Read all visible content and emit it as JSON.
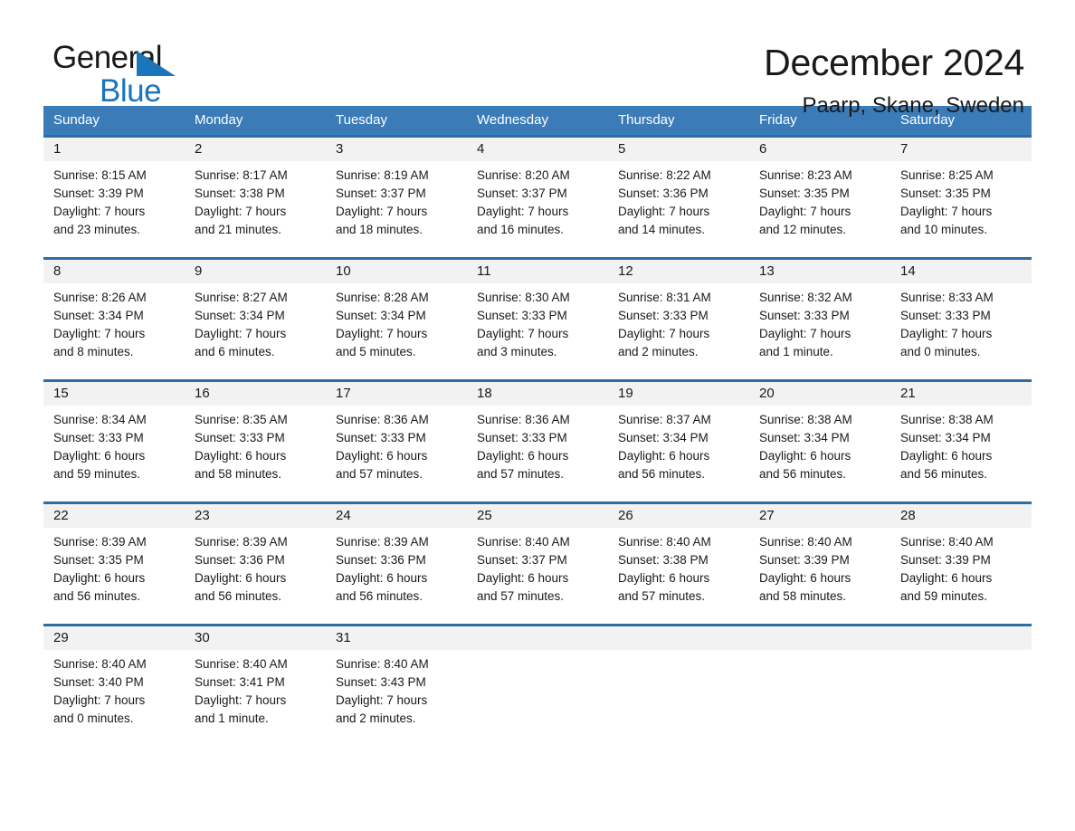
{
  "brand": {
    "name_top": "General",
    "name_bottom": "Blue",
    "accent_color": "#1b75bb"
  },
  "header": {
    "title": "December 2024",
    "subtitle": "Paarp, Skane, Sweden"
  },
  "theme": {
    "header_bg": "#3b7cb8",
    "row_border": "#2e6da4",
    "day_number_bg": "#f2f2f2",
    "text": "#1a1a1a"
  },
  "weekdays": [
    "Sunday",
    "Monday",
    "Tuesday",
    "Wednesday",
    "Thursday",
    "Friday",
    "Saturday"
  ],
  "weeks": [
    [
      {
        "day": "1",
        "sunrise": "Sunrise: 8:15 AM",
        "sunset": "Sunset: 3:39 PM",
        "daylight_line1": "Daylight: 7 hours",
        "daylight_line2": "and 23 minutes."
      },
      {
        "day": "2",
        "sunrise": "Sunrise: 8:17 AM",
        "sunset": "Sunset: 3:38 PM",
        "daylight_line1": "Daylight: 7 hours",
        "daylight_line2": "and 21 minutes."
      },
      {
        "day": "3",
        "sunrise": "Sunrise: 8:19 AM",
        "sunset": "Sunset: 3:37 PM",
        "daylight_line1": "Daylight: 7 hours",
        "daylight_line2": "and 18 minutes."
      },
      {
        "day": "4",
        "sunrise": "Sunrise: 8:20 AM",
        "sunset": "Sunset: 3:37 PM",
        "daylight_line1": "Daylight: 7 hours",
        "daylight_line2": "and 16 minutes."
      },
      {
        "day": "5",
        "sunrise": "Sunrise: 8:22 AM",
        "sunset": "Sunset: 3:36 PM",
        "daylight_line1": "Daylight: 7 hours",
        "daylight_line2": "and 14 minutes."
      },
      {
        "day": "6",
        "sunrise": "Sunrise: 8:23 AM",
        "sunset": "Sunset: 3:35 PM",
        "daylight_line1": "Daylight: 7 hours",
        "daylight_line2": "and 12 minutes."
      },
      {
        "day": "7",
        "sunrise": "Sunrise: 8:25 AM",
        "sunset": "Sunset: 3:35 PM",
        "daylight_line1": "Daylight: 7 hours",
        "daylight_line2": "and 10 minutes."
      }
    ],
    [
      {
        "day": "8",
        "sunrise": "Sunrise: 8:26 AM",
        "sunset": "Sunset: 3:34 PM",
        "daylight_line1": "Daylight: 7 hours",
        "daylight_line2": "and 8 minutes."
      },
      {
        "day": "9",
        "sunrise": "Sunrise: 8:27 AM",
        "sunset": "Sunset: 3:34 PM",
        "daylight_line1": "Daylight: 7 hours",
        "daylight_line2": "and 6 minutes."
      },
      {
        "day": "10",
        "sunrise": "Sunrise: 8:28 AM",
        "sunset": "Sunset: 3:34 PM",
        "daylight_line1": "Daylight: 7 hours",
        "daylight_line2": "and 5 minutes."
      },
      {
        "day": "11",
        "sunrise": "Sunrise: 8:30 AM",
        "sunset": "Sunset: 3:33 PM",
        "daylight_line1": "Daylight: 7 hours",
        "daylight_line2": "and 3 minutes."
      },
      {
        "day": "12",
        "sunrise": "Sunrise: 8:31 AM",
        "sunset": "Sunset: 3:33 PM",
        "daylight_line1": "Daylight: 7 hours",
        "daylight_line2": "and 2 minutes."
      },
      {
        "day": "13",
        "sunrise": "Sunrise: 8:32 AM",
        "sunset": "Sunset: 3:33 PM",
        "daylight_line1": "Daylight: 7 hours",
        "daylight_line2": "and 1 minute."
      },
      {
        "day": "14",
        "sunrise": "Sunrise: 8:33 AM",
        "sunset": "Sunset: 3:33 PM",
        "daylight_line1": "Daylight: 7 hours",
        "daylight_line2": "and 0 minutes."
      }
    ],
    [
      {
        "day": "15",
        "sunrise": "Sunrise: 8:34 AM",
        "sunset": "Sunset: 3:33 PM",
        "daylight_line1": "Daylight: 6 hours",
        "daylight_line2": "and 59 minutes."
      },
      {
        "day": "16",
        "sunrise": "Sunrise: 8:35 AM",
        "sunset": "Sunset: 3:33 PM",
        "daylight_line1": "Daylight: 6 hours",
        "daylight_line2": "and 58 minutes."
      },
      {
        "day": "17",
        "sunrise": "Sunrise: 8:36 AM",
        "sunset": "Sunset: 3:33 PM",
        "daylight_line1": "Daylight: 6 hours",
        "daylight_line2": "and 57 minutes."
      },
      {
        "day": "18",
        "sunrise": "Sunrise: 8:36 AM",
        "sunset": "Sunset: 3:33 PM",
        "daylight_line1": "Daylight: 6 hours",
        "daylight_line2": "and 57 minutes."
      },
      {
        "day": "19",
        "sunrise": "Sunrise: 8:37 AM",
        "sunset": "Sunset: 3:34 PM",
        "daylight_line1": "Daylight: 6 hours",
        "daylight_line2": "and 56 minutes."
      },
      {
        "day": "20",
        "sunrise": "Sunrise: 8:38 AM",
        "sunset": "Sunset: 3:34 PM",
        "daylight_line1": "Daylight: 6 hours",
        "daylight_line2": "and 56 minutes."
      },
      {
        "day": "21",
        "sunrise": "Sunrise: 8:38 AM",
        "sunset": "Sunset: 3:34 PM",
        "daylight_line1": "Daylight: 6 hours",
        "daylight_line2": "and 56 minutes."
      }
    ],
    [
      {
        "day": "22",
        "sunrise": "Sunrise: 8:39 AM",
        "sunset": "Sunset: 3:35 PM",
        "daylight_line1": "Daylight: 6 hours",
        "daylight_line2": "and 56 minutes."
      },
      {
        "day": "23",
        "sunrise": "Sunrise: 8:39 AM",
        "sunset": "Sunset: 3:36 PM",
        "daylight_line1": "Daylight: 6 hours",
        "daylight_line2": "and 56 minutes."
      },
      {
        "day": "24",
        "sunrise": "Sunrise: 8:39 AM",
        "sunset": "Sunset: 3:36 PM",
        "daylight_line1": "Daylight: 6 hours",
        "daylight_line2": "and 56 minutes."
      },
      {
        "day": "25",
        "sunrise": "Sunrise: 8:40 AM",
        "sunset": "Sunset: 3:37 PM",
        "daylight_line1": "Daylight: 6 hours",
        "daylight_line2": "and 57 minutes."
      },
      {
        "day": "26",
        "sunrise": "Sunrise: 8:40 AM",
        "sunset": "Sunset: 3:38 PM",
        "daylight_line1": "Daylight: 6 hours",
        "daylight_line2": "and 57 minutes."
      },
      {
        "day": "27",
        "sunrise": "Sunrise: 8:40 AM",
        "sunset": "Sunset: 3:39 PM",
        "daylight_line1": "Daylight: 6 hours",
        "daylight_line2": "and 58 minutes."
      },
      {
        "day": "28",
        "sunrise": "Sunrise: 8:40 AM",
        "sunset": "Sunset: 3:39 PM",
        "daylight_line1": "Daylight: 6 hours",
        "daylight_line2": "and 59 minutes."
      }
    ],
    [
      {
        "day": "29",
        "sunrise": "Sunrise: 8:40 AM",
        "sunset": "Sunset: 3:40 PM",
        "daylight_line1": "Daylight: 7 hours",
        "daylight_line2": "and 0 minutes."
      },
      {
        "day": "30",
        "sunrise": "Sunrise: 8:40 AM",
        "sunset": "Sunset: 3:41 PM",
        "daylight_line1": "Daylight: 7 hours",
        "daylight_line2": "and 1 minute."
      },
      {
        "day": "31",
        "sunrise": "Sunrise: 8:40 AM",
        "sunset": "Sunset: 3:43 PM",
        "daylight_line1": "Daylight: 7 hours",
        "daylight_line2": "and 2 minutes."
      },
      {
        "day": "",
        "sunrise": "",
        "sunset": "",
        "daylight_line1": "",
        "daylight_line2": ""
      },
      {
        "day": "",
        "sunrise": "",
        "sunset": "",
        "daylight_line1": "",
        "daylight_line2": ""
      },
      {
        "day": "",
        "sunrise": "",
        "sunset": "",
        "daylight_line1": "",
        "daylight_line2": ""
      },
      {
        "day": "",
        "sunrise": "",
        "sunset": "",
        "daylight_line1": "",
        "daylight_line2": ""
      }
    ]
  ]
}
